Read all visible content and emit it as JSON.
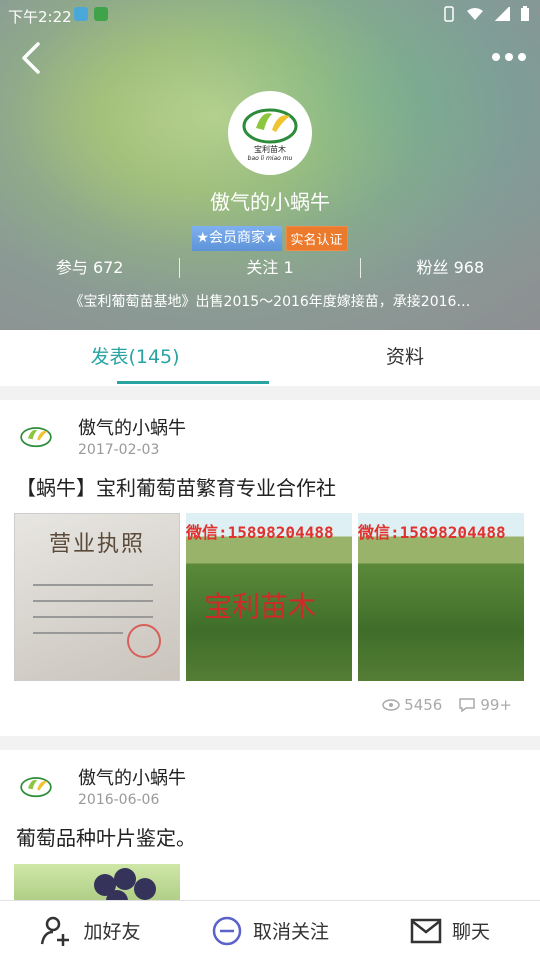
{
  "status_bar": {
    "time": "下午2:22"
  },
  "profile": {
    "nickname": "傲气的小蜗牛",
    "badge_member": "★会员商家★",
    "badge_verified": "实名认证",
    "stats": [
      {
        "label": "参与",
        "value": "672"
      },
      {
        "label": "关注",
        "value": "1"
      },
      {
        "label": "粉丝",
        "value": "968"
      }
    ],
    "intro": "《宝利葡萄苗基地》出售2015～2016年度嫁接苗，承接2016…",
    "logo_text": "宝利苗木",
    "logo_pinyin": "bao li miao mu"
  },
  "tabs": [
    {
      "label": "发表(145)",
      "active": true
    },
    {
      "label": "资料",
      "active": false
    }
  ],
  "posts": [
    {
      "author": "傲气的小蜗牛",
      "date": "2017-02-03",
      "title": "【蜗牛】宝利葡萄苗繁育专业合作社",
      "images": {
        "license_title": "营业执照",
        "watermark": "微信:15898204488",
        "field_text": "宝利苗木"
      },
      "views": "5456",
      "comments": "99+"
    },
    {
      "author": "傲气的小蜗牛",
      "date": "2016-06-06",
      "title": "葡萄品种叶片鉴定。"
    }
  ],
  "bottom_bar": {
    "add_friend": "加好友",
    "unfollow": "取消关注",
    "chat": "聊天"
  },
  "colors": {
    "accent": "#2aa3a3",
    "verified": "#ec7a2d"
  }
}
